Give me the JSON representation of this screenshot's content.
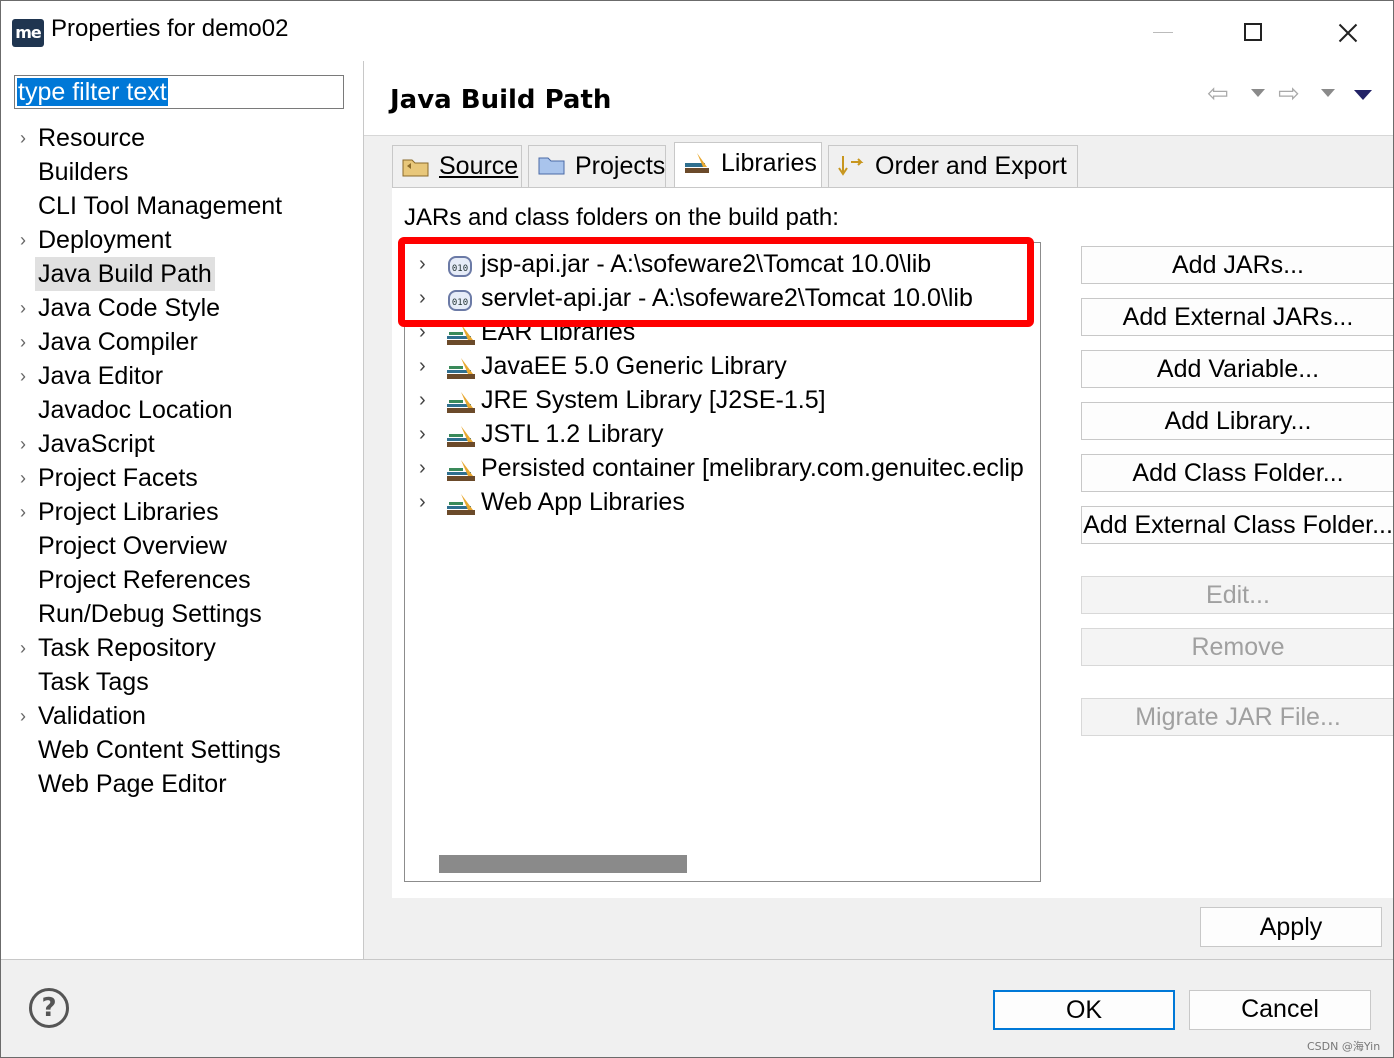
{
  "window": {
    "title": "Properties for demo02",
    "app_icon_text": "me"
  },
  "filter": {
    "value": "type filter text"
  },
  "nav": [
    {
      "label": "Resource",
      "expandable": true
    },
    {
      "label": "Builders",
      "expandable": false
    },
    {
      "label": "CLI Tool Management",
      "expandable": false
    },
    {
      "label": "Deployment",
      "expandable": true
    },
    {
      "label": "Java Build Path",
      "expandable": false,
      "selected": true
    },
    {
      "label": "Java Code Style",
      "expandable": true
    },
    {
      "label": "Java Compiler",
      "expandable": true
    },
    {
      "label": "Java Editor",
      "expandable": true
    },
    {
      "label": "Javadoc Location",
      "expandable": false
    },
    {
      "label": "JavaScript",
      "expandable": true
    },
    {
      "label": "Project Facets",
      "expandable": true
    },
    {
      "label": "Project Libraries",
      "expandable": true
    },
    {
      "label": "Project Overview",
      "expandable": false
    },
    {
      "label": "Project References",
      "expandable": false
    },
    {
      "label": "Run/Debug Settings",
      "expandable": false
    },
    {
      "label": "Task Repository",
      "expandable": true
    },
    {
      "label": "Task Tags",
      "expandable": false
    },
    {
      "label": "Validation",
      "expandable": true
    },
    {
      "label": "Web Content Settings",
      "expandable": false
    },
    {
      "label": "Web Page Editor",
      "expandable": false
    }
  ],
  "page": {
    "title": "Java Build Path"
  },
  "tabs": [
    {
      "label": "Source",
      "icon": "source-folder-icon"
    },
    {
      "label": "Projects",
      "icon": "projects-folder-icon"
    },
    {
      "label": "Libraries",
      "icon": "libraries-icon",
      "active": true
    },
    {
      "label": "Order and Export",
      "icon": "order-export-icon"
    }
  ],
  "libraries": {
    "heading": "JARs and class folders on the build path:",
    "entries": [
      {
        "label": "jsp-api.jar - A:\\sofeware2\\Tomcat 10.0\\lib",
        "icon": "jar-icon"
      },
      {
        "label": "servlet-api.jar - A:\\sofeware2\\Tomcat 10.0\\lib",
        "icon": "jar-icon"
      },
      {
        "label": "EAR Libraries",
        "icon": "library-icon"
      },
      {
        "label": "JavaEE 5.0 Generic Library",
        "icon": "library-icon"
      },
      {
        "label": "JRE System Library [J2SE-1.5]",
        "icon": "library-icon"
      },
      {
        "label": "JSTL 1.2 Library",
        "icon": "library-icon"
      },
      {
        "label": "Persisted container [melibrary.com.genuitec.eclip",
        "icon": "library-icon"
      },
      {
        "label": "Web App Libraries",
        "icon": "library-icon"
      }
    ]
  },
  "buttons": {
    "add_jars": "Add JARs...",
    "add_external_jars": "Add External JARs...",
    "add_variable": "Add Variable...",
    "add_library": "Add Library...",
    "add_class_folder": "Add Class Folder...",
    "add_external_class_folder": "Add External Class Folder...",
    "edit": "Edit...",
    "remove": "Remove",
    "migrate_jar": "Migrate JAR File...",
    "apply": "Apply",
    "ok": "OK",
    "cancel": "Cancel"
  },
  "watermark": "CSDN @海Yin",
  "colors": {
    "highlight": "#ff0000",
    "selection": "#0078d7",
    "ok_border": "#0078d7"
  }
}
